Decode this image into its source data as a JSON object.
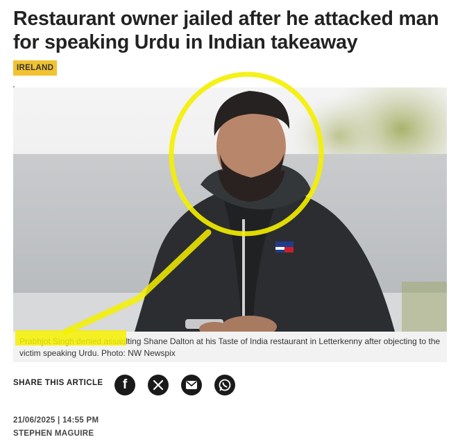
{
  "article": {
    "headline": "Restaurant owner jailed after he attacked man for speaking Urdu in Indian takeaway",
    "section_tag": "IRELAND",
    "caption": "Prabhjot Singh denied assaulting Shane Dalton at his Taste of India restaurant in Letterkenny after objecting to the victim speaking Urdu. Photo: NW Newspix",
    "date_time": "21/06/2025 | 14:55 PM",
    "author": "STEPHEN MAGUIRE"
  },
  "share": {
    "label": "SHARE THIS ARTICLE",
    "buttons": [
      {
        "icon": "facebook-icon",
        "glyph": "f"
      },
      {
        "icon": "x-icon",
        "glyph": "X"
      },
      {
        "icon": "email-icon",
        "glyph": "email"
      },
      {
        "icon": "whatsapp-icon",
        "glyph": "whatsapp"
      }
    ]
  },
  "colors": {
    "tag_bg": "#f2c230",
    "highlight": "#f4f000",
    "jacket": "#2b2d30"
  }
}
